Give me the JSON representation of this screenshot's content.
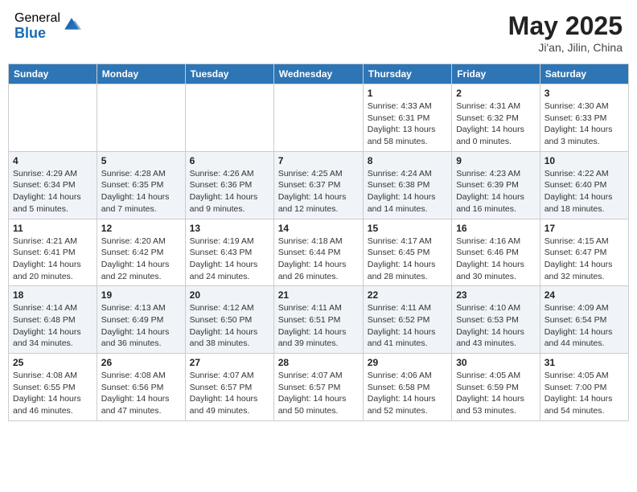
{
  "header": {
    "logo_general": "General",
    "logo_blue": "Blue",
    "title": "May 2025",
    "location": "Ji'an, Jilin, China"
  },
  "weekdays": [
    "Sunday",
    "Monday",
    "Tuesday",
    "Wednesday",
    "Thursday",
    "Friday",
    "Saturday"
  ],
  "weeks": [
    [
      {
        "day": "",
        "info": ""
      },
      {
        "day": "",
        "info": ""
      },
      {
        "day": "",
        "info": ""
      },
      {
        "day": "",
        "info": ""
      },
      {
        "day": "1",
        "info": "Sunrise: 4:33 AM\nSunset: 6:31 PM\nDaylight: 13 hours\nand 58 minutes."
      },
      {
        "day": "2",
        "info": "Sunrise: 4:31 AM\nSunset: 6:32 PM\nDaylight: 14 hours\nand 0 minutes."
      },
      {
        "day": "3",
        "info": "Sunrise: 4:30 AM\nSunset: 6:33 PM\nDaylight: 14 hours\nand 3 minutes."
      }
    ],
    [
      {
        "day": "4",
        "info": "Sunrise: 4:29 AM\nSunset: 6:34 PM\nDaylight: 14 hours\nand 5 minutes."
      },
      {
        "day": "5",
        "info": "Sunrise: 4:28 AM\nSunset: 6:35 PM\nDaylight: 14 hours\nand 7 minutes."
      },
      {
        "day": "6",
        "info": "Sunrise: 4:26 AM\nSunset: 6:36 PM\nDaylight: 14 hours\nand 9 minutes."
      },
      {
        "day": "7",
        "info": "Sunrise: 4:25 AM\nSunset: 6:37 PM\nDaylight: 14 hours\nand 12 minutes."
      },
      {
        "day": "8",
        "info": "Sunrise: 4:24 AM\nSunset: 6:38 PM\nDaylight: 14 hours\nand 14 minutes."
      },
      {
        "day": "9",
        "info": "Sunrise: 4:23 AM\nSunset: 6:39 PM\nDaylight: 14 hours\nand 16 minutes."
      },
      {
        "day": "10",
        "info": "Sunrise: 4:22 AM\nSunset: 6:40 PM\nDaylight: 14 hours\nand 18 minutes."
      }
    ],
    [
      {
        "day": "11",
        "info": "Sunrise: 4:21 AM\nSunset: 6:41 PM\nDaylight: 14 hours\nand 20 minutes."
      },
      {
        "day": "12",
        "info": "Sunrise: 4:20 AM\nSunset: 6:42 PM\nDaylight: 14 hours\nand 22 minutes."
      },
      {
        "day": "13",
        "info": "Sunrise: 4:19 AM\nSunset: 6:43 PM\nDaylight: 14 hours\nand 24 minutes."
      },
      {
        "day": "14",
        "info": "Sunrise: 4:18 AM\nSunset: 6:44 PM\nDaylight: 14 hours\nand 26 minutes."
      },
      {
        "day": "15",
        "info": "Sunrise: 4:17 AM\nSunset: 6:45 PM\nDaylight: 14 hours\nand 28 minutes."
      },
      {
        "day": "16",
        "info": "Sunrise: 4:16 AM\nSunset: 6:46 PM\nDaylight: 14 hours\nand 30 minutes."
      },
      {
        "day": "17",
        "info": "Sunrise: 4:15 AM\nSunset: 6:47 PM\nDaylight: 14 hours\nand 32 minutes."
      }
    ],
    [
      {
        "day": "18",
        "info": "Sunrise: 4:14 AM\nSunset: 6:48 PM\nDaylight: 14 hours\nand 34 minutes."
      },
      {
        "day": "19",
        "info": "Sunrise: 4:13 AM\nSunset: 6:49 PM\nDaylight: 14 hours\nand 36 minutes."
      },
      {
        "day": "20",
        "info": "Sunrise: 4:12 AM\nSunset: 6:50 PM\nDaylight: 14 hours\nand 38 minutes."
      },
      {
        "day": "21",
        "info": "Sunrise: 4:11 AM\nSunset: 6:51 PM\nDaylight: 14 hours\nand 39 minutes."
      },
      {
        "day": "22",
        "info": "Sunrise: 4:11 AM\nSunset: 6:52 PM\nDaylight: 14 hours\nand 41 minutes."
      },
      {
        "day": "23",
        "info": "Sunrise: 4:10 AM\nSunset: 6:53 PM\nDaylight: 14 hours\nand 43 minutes."
      },
      {
        "day": "24",
        "info": "Sunrise: 4:09 AM\nSunset: 6:54 PM\nDaylight: 14 hours\nand 44 minutes."
      }
    ],
    [
      {
        "day": "25",
        "info": "Sunrise: 4:08 AM\nSunset: 6:55 PM\nDaylight: 14 hours\nand 46 minutes."
      },
      {
        "day": "26",
        "info": "Sunrise: 4:08 AM\nSunset: 6:56 PM\nDaylight: 14 hours\nand 47 minutes."
      },
      {
        "day": "27",
        "info": "Sunrise: 4:07 AM\nSunset: 6:57 PM\nDaylight: 14 hours\nand 49 minutes."
      },
      {
        "day": "28",
        "info": "Sunrise: 4:07 AM\nSunset: 6:57 PM\nDaylight: 14 hours\nand 50 minutes."
      },
      {
        "day": "29",
        "info": "Sunrise: 4:06 AM\nSunset: 6:58 PM\nDaylight: 14 hours\nand 52 minutes."
      },
      {
        "day": "30",
        "info": "Sunrise: 4:05 AM\nSunset: 6:59 PM\nDaylight: 14 hours\nand 53 minutes."
      },
      {
        "day": "31",
        "info": "Sunrise: 4:05 AM\nSunset: 7:00 PM\nDaylight: 14 hours\nand 54 minutes."
      }
    ]
  ]
}
